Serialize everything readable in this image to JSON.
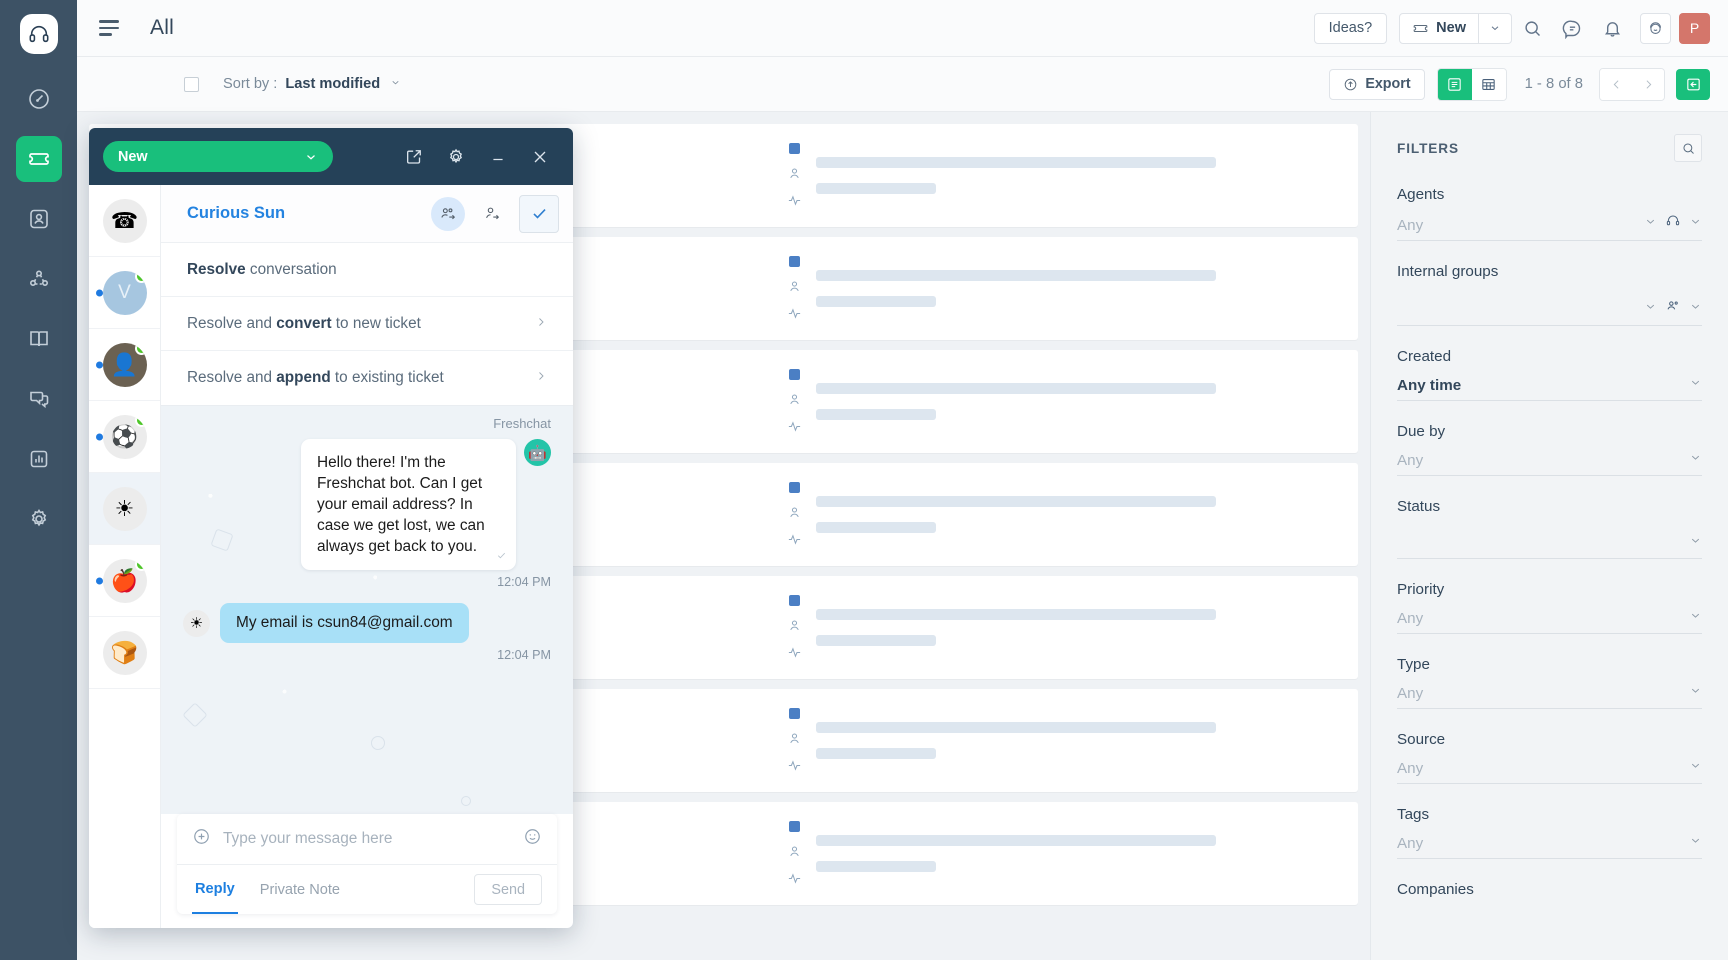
{
  "rail": {
    "logo_icon": "headset-logo-icon",
    "items": [
      {
        "name": "dashboard",
        "icon": "gauge-icon",
        "active": false
      },
      {
        "name": "tickets",
        "icon": "ticket-icon",
        "active": true
      },
      {
        "name": "contacts",
        "icon": "contact-card-icon",
        "active": false
      },
      {
        "name": "customers",
        "icon": "network-icon",
        "active": false
      },
      {
        "name": "solutions",
        "icon": "book-icon",
        "active": false
      },
      {
        "name": "forums",
        "icon": "chat-bubbles-icon",
        "active": false
      },
      {
        "name": "analytics",
        "icon": "bar-chart-icon",
        "active": false
      },
      {
        "name": "admin",
        "icon": "gear-icon",
        "active": false
      }
    ]
  },
  "topbar": {
    "menu_icon": "hamburger-icon",
    "title": "All",
    "ideas_label": "Ideas?",
    "new_label": "New",
    "new_icon": "ticket-icon",
    "search_icon": "search-icon",
    "feedback_icon": "chat-bubble-icon",
    "bell_icon": "bell-icon",
    "support_icon": "emoji-headset-icon",
    "avatar_initial": "P",
    "avatar_color": "#d4766b"
  },
  "subbar": {
    "select_all": "select-all-checkbox",
    "sort_label": "Sort by :",
    "sort_value": "Last modified",
    "export_label": "Export",
    "export_icon": "upload-icon",
    "view_list_icon": "list-view-icon",
    "view_table_icon": "table-view-icon",
    "active_view": "list",
    "pagination": "1 - 8 of 8",
    "prev_icon": "chevron-left-icon",
    "next_icon": "chevron-right-icon",
    "collapse_icon": "panel-collapse-icon",
    "accent": "#19bf7c"
  },
  "list": {
    "rows": [
      {
        "id": "row-1"
      },
      {
        "id": "row-2"
      },
      {
        "id": "row-3"
      },
      {
        "id": "row-4"
      },
      {
        "id": "row-5"
      },
      {
        "id": "row-6"
      },
      {
        "id": "row-7"
      }
    ]
  },
  "filters": {
    "title": "FILTERS",
    "search_icon": "search-icon",
    "groups": [
      {
        "label": "Agents",
        "value": "Any",
        "strong": false,
        "extra_icon": "headset-icon"
      },
      {
        "label": "Internal groups",
        "value": "",
        "strong": false,
        "extra_icon": "people-icon"
      },
      {
        "label": "Created",
        "value": "Any time",
        "strong": true,
        "extra_icon": ""
      },
      {
        "label": "Due by",
        "value": "Any",
        "strong": false,
        "extra_icon": ""
      },
      {
        "label": "Status",
        "value": "",
        "strong": false,
        "extra_icon": ""
      },
      {
        "label": "Priority",
        "value": "Any",
        "strong": false,
        "extra_icon": ""
      },
      {
        "label": "Type",
        "value": "Any",
        "strong": false,
        "extra_icon": ""
      },
      {
        "label": "Source",
        "value": "Any",
        "strong": false,
        "extra_icon": ""
      },
      {
        "label": "Tags",
        "value": "Any",
        "strong": false,
        "extra_icon": ""
      },
      {
        "label": "Companies",
        "value": "",
        "strong": false,
        "extra_icon": ""
      }
    ]
  },
  "chat": {
    "status_label": "New",
    "status_caret_icon": "chevron-down-icon",
    "popout_icon": "external-link-icon",
    "settings_icon": "gear-icon",
    "minimize_icon": "minimize-icon",
    "close_icon": "close-icon",
    "conversations": [
      {
        "avatar": "telephone",
        "emoji": "☎",
        "online": false,
        "unread": false,
        "selected": false
      },
      {
        "avatar": "letter",
        "emoji": "V",
        "online": true,
        "unread": true,
        "selected": false
      },
      {
        "avatar": "photo",
        "emoji": "",
        "online": true,
        "unread": true,
        "selected": false
      },
      {
        "avatar": "soccer",
        "emoji": "⚽",
        "online": true,
        "unread": true,
        "selected": false
      },
      {
        "avatar": "sun",
        "emoji": "☀",
        "online": false,
        "unread": false,
        "selected": true
      },
      {
        "avatar": "apple",
        "emoji": "🍎",
        "online": true,
        "unread": true,
        "selected": false
      },
      {
        "avatar": "bread",
        "emoji": "🍞",
        "online": false,
        "unread": false,
        "selected": false
      }
    ],
    "contact_name": "Curious Sun",
    "assign_group_icon": "assign-group-icon",
    "assign_agent-icon": "assign-agent-icon",
    "assign_agent_icon": "assign-agent-icon",
    "resolve_icon": "check-icon",
    "menu": [
      {
        "pre": "",
        "bold": "Resolve",
        "post": " conversation",
        "has_arrow": false
      },
      {
        "pre": "Resolve and ",
        "bold": "convert",
        "post": " to new ticket",
        "has_arrow": true
      },
      {
        "pre": "Resolve and ",
        "bold": "append",
        "post": " to existing ticket",
        "has_arrow": true
      }
    ],
    "channel_label": "Freshchat",
    "messages": [
      {
        "from": "bot",
        "text": "Hello there! I'm the Freshchat bot. Can I get your email address? In case we get lost, we can always get back to you.",
        "time": "12:04 PM",
        "avatar_emoji": "🤖",
        "delivered_icon": "check-icon"
      },
      {
        "from": "user",
        "text": "My email is csun84@gmail.com",
        "time": "12:04 PM",
        "avatar_emoji": "☀"
      }
    ],
    "composer": {
      "attach_icon": "plus-circle-icon",
      "placeholder": "Type your message here",
      "value": "",
      "emoji_icon": "smiley-icon",
      "tab_reply": "Reply",
      "tab_note": "Private Note",
      "send_label": "Send"
    }
  }
}
